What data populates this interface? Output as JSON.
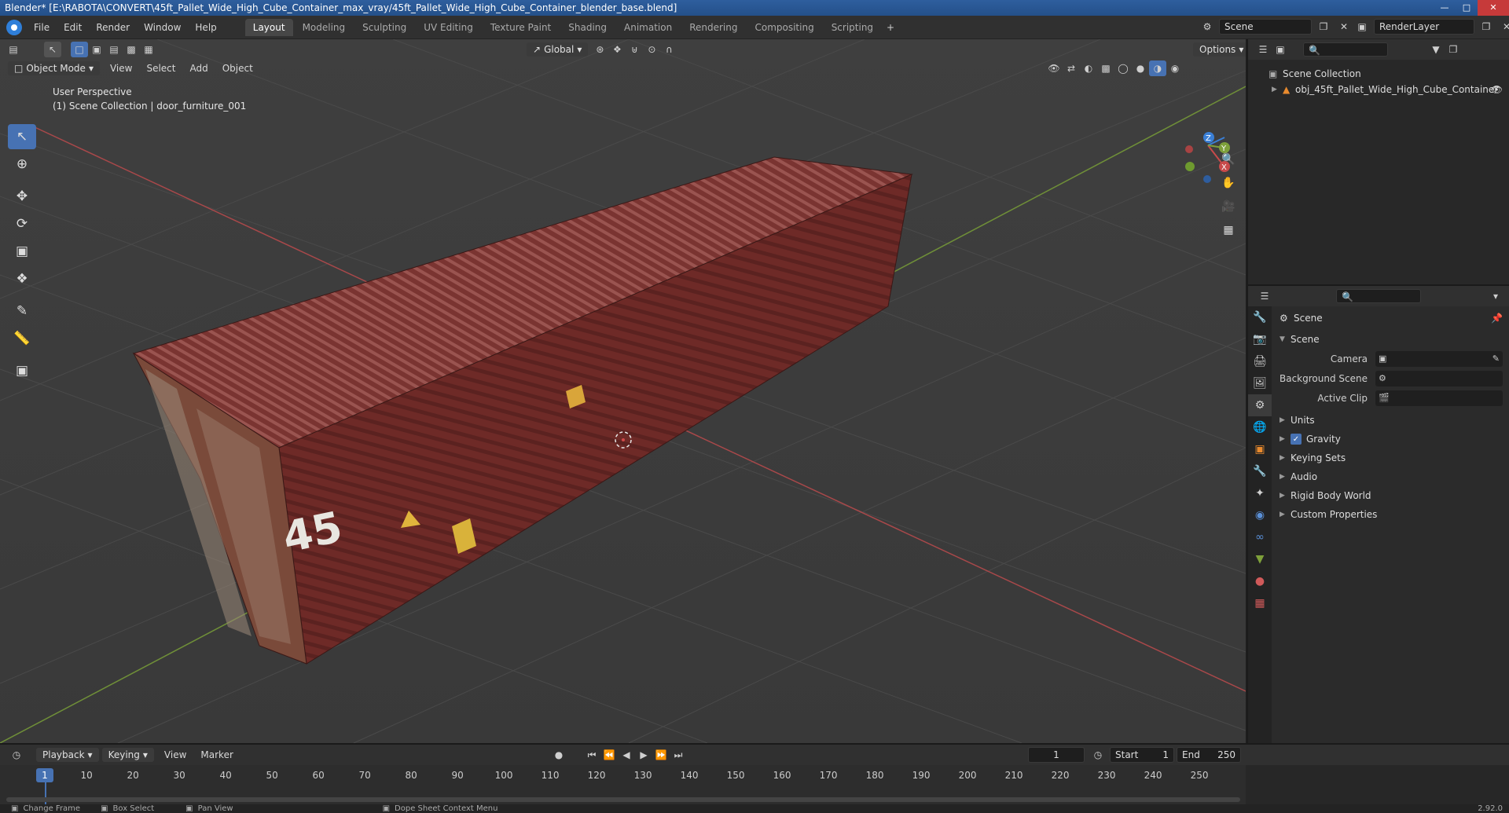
{
  "window": {
    "title": "Blender* [E:\\RABOTA\\CONVERT\\45ft_Pallet_Wide_High_Cube_Container_max_vray/45ft_Pallet_Wide_High_Cube_Container_blender_base.blend]"
  },
  "menu": [
    "File",
    "Edit",
    "Render",
    "Window",
    "Help"
  ],
  "workspaces": [
    "Layout",
    "Modeling",
    "Sculpting",
    "UV Editing",
    "Texture Paint",
    "Shading",
    "Animation",
    "Rendering",
    "Compositing",
    "Scripting"
  ],
  "active_workspace": "Layout",
  "scene_field": "Scene",
  "render_layer_field": "RenderLayer",
  "viewport_header": {
    "mode": "Object Mode",
    "menus": [
      "View",
      "Select",
      "Add",
      "Object"
    ],
    "transform_orientation": "Global",
    "options": "Options"
  },
  "viewport_overlay": {
    "perspective": "User Perspective",
    "collection_info": "(1) Scene Collection | door_furniture_001"
  },
  "model_label": "45",
  "gizmo_axes": {
    "x": "X",
    "y": "Y",
    "z": "Z"
  },
  "outliner": {
    "root": "Scene Collection",
    "items": [
      {
        "label": "obj_45ft_Pallet_Wide_High_Cube_Container"
      }
    ]
  },
  "properties": {
    "context_title": "Scene",
    "scene_panel": "Scene",
    "fields": [
      {
        "label": "Camera",
        "value": ""
      },
      {
        "label": "Background Scene",
        "value": ""
      },
      {
        "label": "Active Clip",
        "value": ""
      }
    ],
    "panels": [
      {
        "label": "Units",
        "checkbox": false
      },
      {
        "label": "Gravity",
        "checkbox": true
      },
      {
        "label": "Keying Sets",
        "checkbox": false
      },
      {
        "label": "Audio",
        "checkbox": false
      },
      {
        "label": "Rigid Body World",
        "checkbox": false
      },
      {
        "label": "Custom Properties",
        "checkbox": false
      }
    ]
  },
  "timeline": {
    "menus": [
      "Playback",
      "Keying",
      "View",
      "Marker"
    ],
    "current_frame": "1",
    "start_label": "Start",
    "start": "1",
    "end_label": "End",
    "end": "250",
    "ruler": [
      "1",
      "10",
      "20",
      "30",
      "40",
      "50",
      "60",
      "70",
      "80",
      "90",
      "100",
      "110",
      "120",
      "130",
      "140",
      "150",
      "160",
      "170",
      "180",
      "190",
      "200",
      "210",
      "220",
      "230",
      "240",
      "250"
    ]
  },
  "statusbar": {
    "items": [
      "Change Frame",
      "Box Select",
      "Pan View",
      "Dope Sheet Context Menu"
    ],
    "version": "2.92.0"
  },
  "colors": {
    "accent": "#4772b3",
    "container": "#6b2a26",
    "x_axis": "#c84a4a",
    "y_axis": "#7ea03a",
    "z_axis": "#3a7fd6"
  }
}
